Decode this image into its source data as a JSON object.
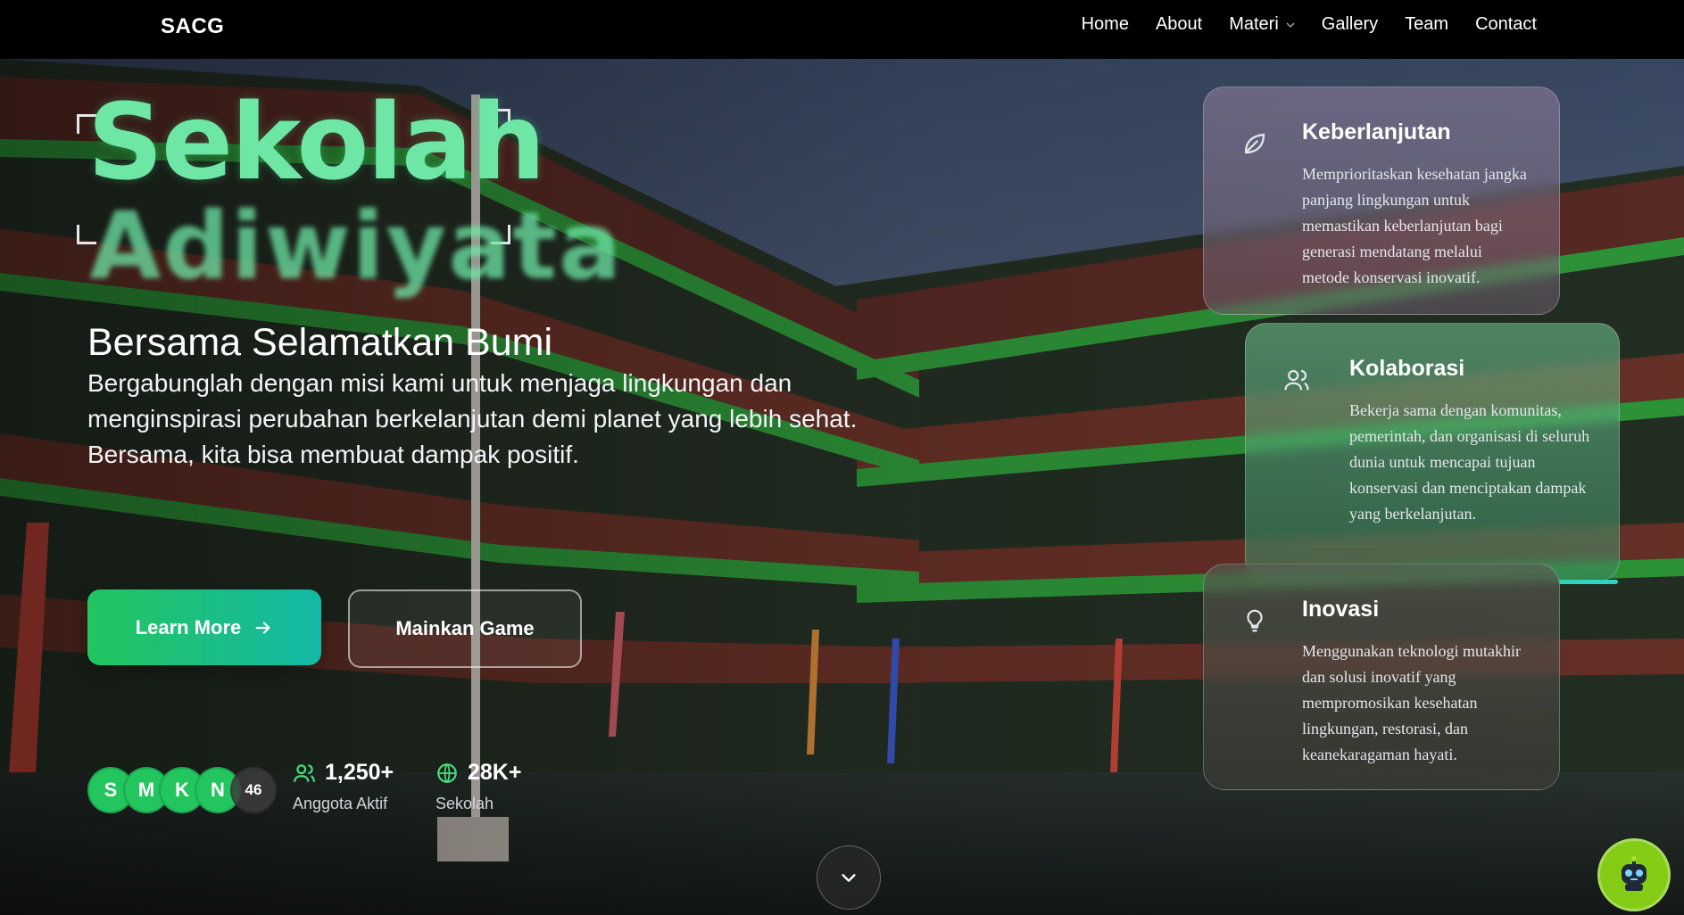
{
  "nav": {
    "brand": "SACG",
    "items": [
      "Home",
      "About",
      "Materi",
      "Gallery",
      "Team",
      "Contact"
    ]
  },
  "hero": {
    "title_line1": "Sekolah",
    "title_line2": "Adiwiyata",
    "subtitle": "Bersama Selamatkan Bumi",
    "description": "Bergabunglah dengan misi kami untuk menjaga lingkungan dan menginspirasi perubahan berkelanjutan demi planet yang lebih sehat. Bersama, kita bisa membuat dampak positif.",
    "primary_button": "Learn More",
    "secondary_button": "Mainkan Game"
  },
  "stats": {
    "avatars": [
      "S",
      "M",
      "K",
      "N"
    ],
    "avatar_extra": "46",
    "members_value": "1,250+",
    "members_label": "Anggota Aktif",
    "schools_value": "28K+",
    "schools_label": "Sekolah"
  },
  "cards": [
    {
      "icon": "leaf-icon",
      "title": "Keberlanjutan",
      "text": "Memprioritaskan kesehatan jangka panjang lingkungan untuk memastikan keberlanjutan bagi generasi mendatang melalui metode konservasi inovatif."
    },
    {
      "icon": "users-icon",
      "title": "Kolaborasi",
      "text": "Bekerja sama dengan komunitas, pemerintah, dan organisasi di seluruh dunia untuk mencapai tujuan konservasi dan menciptakan dampak yang berkelanjutan."
    },
    {
      "icon": "lightbulb-icon",
      "title": "Inovasi",
      "text": "Menggunakan teknologi mutakhir dan solusi inovatif yang mempromosikan kesehatan lingkungan, restorasi, dan keanekaragaman hayati."
    }
  ],
  "colors": {
    "accent_green": "#22c55e",
    "accent_teal": "#14b8a6",
    "title_green": "#6ee7a6",
    "bot_green": "#84cc16"
  }
}
